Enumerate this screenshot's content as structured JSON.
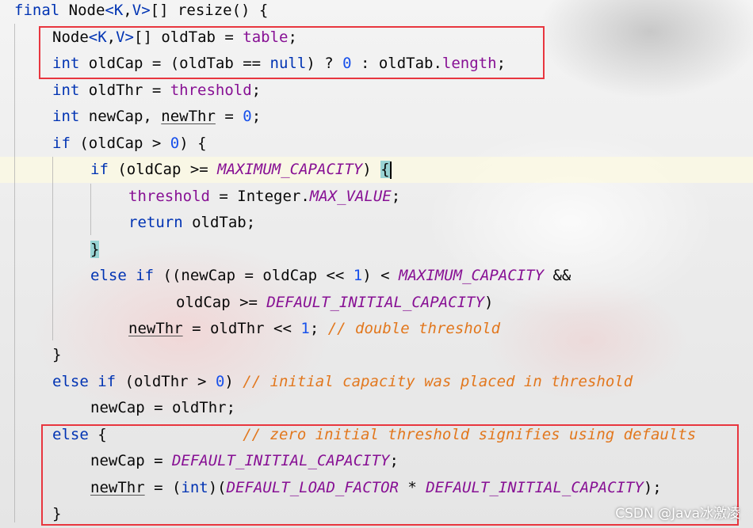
{
  "code": {
    "lines": [
      "final Node<K,V>[] resize() {",
      "Node<K,V>[] oldTab = table;",
      "int oldCap = (oldTab == null) ? 0 : oldTab.length;",
      "int oldThr = threshold;",
      "int newCap, newThr = 0;",
      "if (oldCap > 0) {",
      "if (oldCap >= MAXIMUM_CAPACITY) {",
      "threshold = Integer.MAX_VALUE;",
      "return oldTab;",
      "}",
      "else if ((newCap = oldCap << 1) < MAXIMUM_CAPACITY &&",
      "oldCap >= DEFAULT_INITIAL_CAPACITY)",
      "newThr = oldThr << 1; // double threshold",
      "}",
      "else if (oldThr > 0) // initial capacity was placed in threshold",
      "newCap = oldThr;",
      "else {               // zero initial threshold signifies using defaults",
      "newCap = DEFAULT_INITIAL_CAPACITY;",
      "newThr = (int)(DEFAULT_LOAD_FACTOR * DEFAULT_INITIAL_CAPACITY);",
      "}"
    ]
  },
  "watermark": "CSDN @Java冰激凌",
  "colors": {
    "keyword": "#0033b3",
    "field": "#871094",
    "number": "#1750eb",
    "comment": "#e2771d",
    "highlight_box": "#e8363f",
    "brace_match": "#99d3d3"
  }
}
